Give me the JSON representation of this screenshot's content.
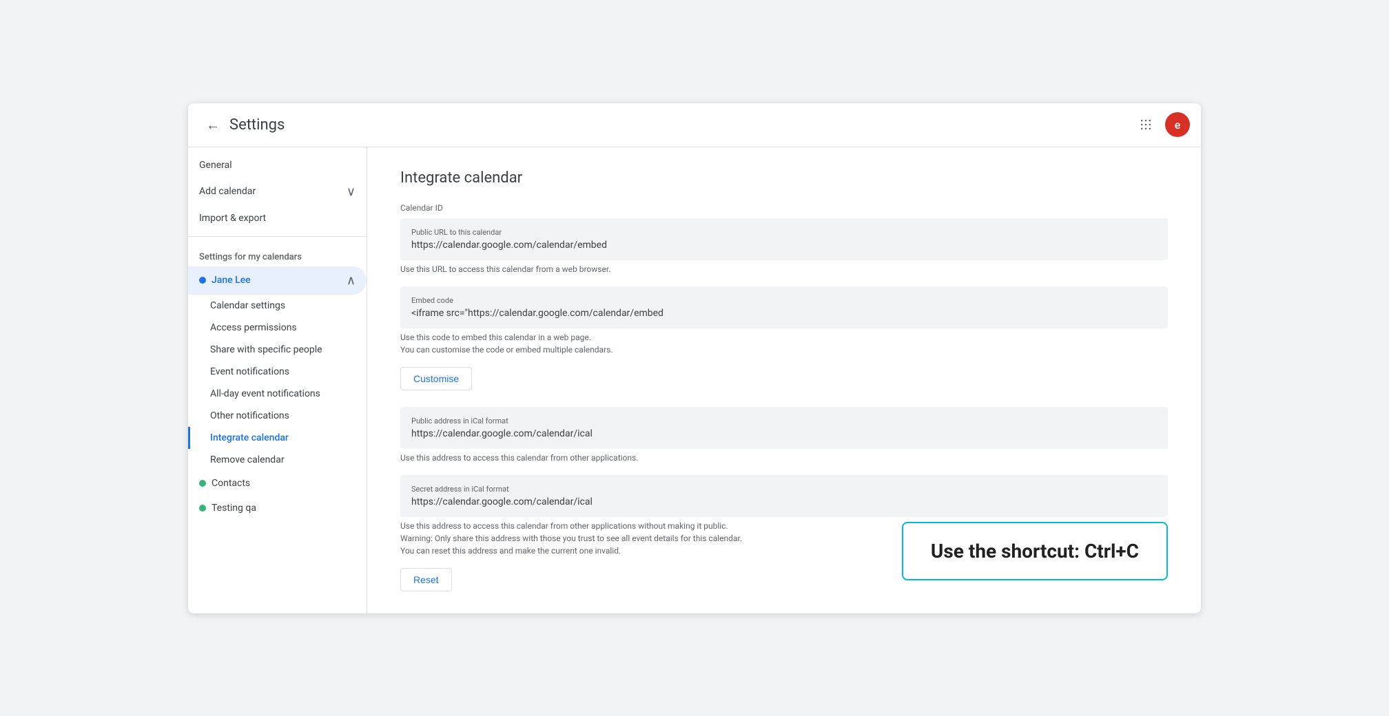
{
  "header": {
    "back_label": "←",
    "title": "Settings",
    "grid_icon": "⋮⋮",
    "avatar_label": "e"
  },
  "sidebar": {
    "general_label": "General",
    "add_calendar_label": "Add calendar",
    "import_export_label": "Import & export",
    "settings_section_label": "Settings for my calendars",
    "jane_lee_label": "Jane Lee",
    "jane_lee_dot_color": "#1a73e8",
    "calendar_settings_label": "Calendar settings",
    "access_permissions_label": "Access permissions",
    "share_with_label": "Share with specific people",
    "event_notifications_label": "Event notifications",
    "allday_notifications_label": "All-day event notifications",
    "other_notifications_label": "Other notifications",
    "integrate_calendar_label": "Integrate calendar",
    "remove_calendar_label": "Remove calendar",
    "contacts_label": "Contacts",
    "contacts_dot_color": "#33b679",
    "testing_qa_label": "Testing qa",
    "testing_qa_dot_color": "#33b679"
  },
  "main": {
    "title": "Integrate calendar",
    "calendar_id_label": "Calendar ID",
    "public_url_label": "Public URL to this calendar",
    "public_url_value": "https://calendar.google.com/calendar/embed",
    "public_url_helper": "Use this URL to access this calendar from a web browser.",
    "embed_code_label": "Embed code",
    "embed_code_value": "<iframe src=\"https://calendar.google.com/calendar/embed",
    "embed_code_helper1": "Use this code to embed this calendar in a web page.",
    "embed_code_helper2": "You can customise the code or embed multiple calendars.",
    "customise_btn_label": "Customise",
    "ical_public_label": "Public address in iCal format",
    "ical_public_value": "https://calendar.google.com/calendar/ical",
    "ical_public_helper": "Use this address to access this calendar from other applications.",
    "ical_secret_label": "Secret address in iCal format",
    "ical_secret_value": "https://calendar.google.com/calendar/ical",
    "ical_secret_helper1": "Use this address to access this calendar from other applications without making it public.",
    "ical_secret_helper2": "Warning: Only share this address with those you trust to see all event details for this calendar.",
    "ical_secret_helper3": "You can reset this address and make the current one invalid.",
    "reset_btn_label": "Reset"
  },
  "shortcut": {
    "text": "Use the shortcut: Ctrl+C"
  }
}
